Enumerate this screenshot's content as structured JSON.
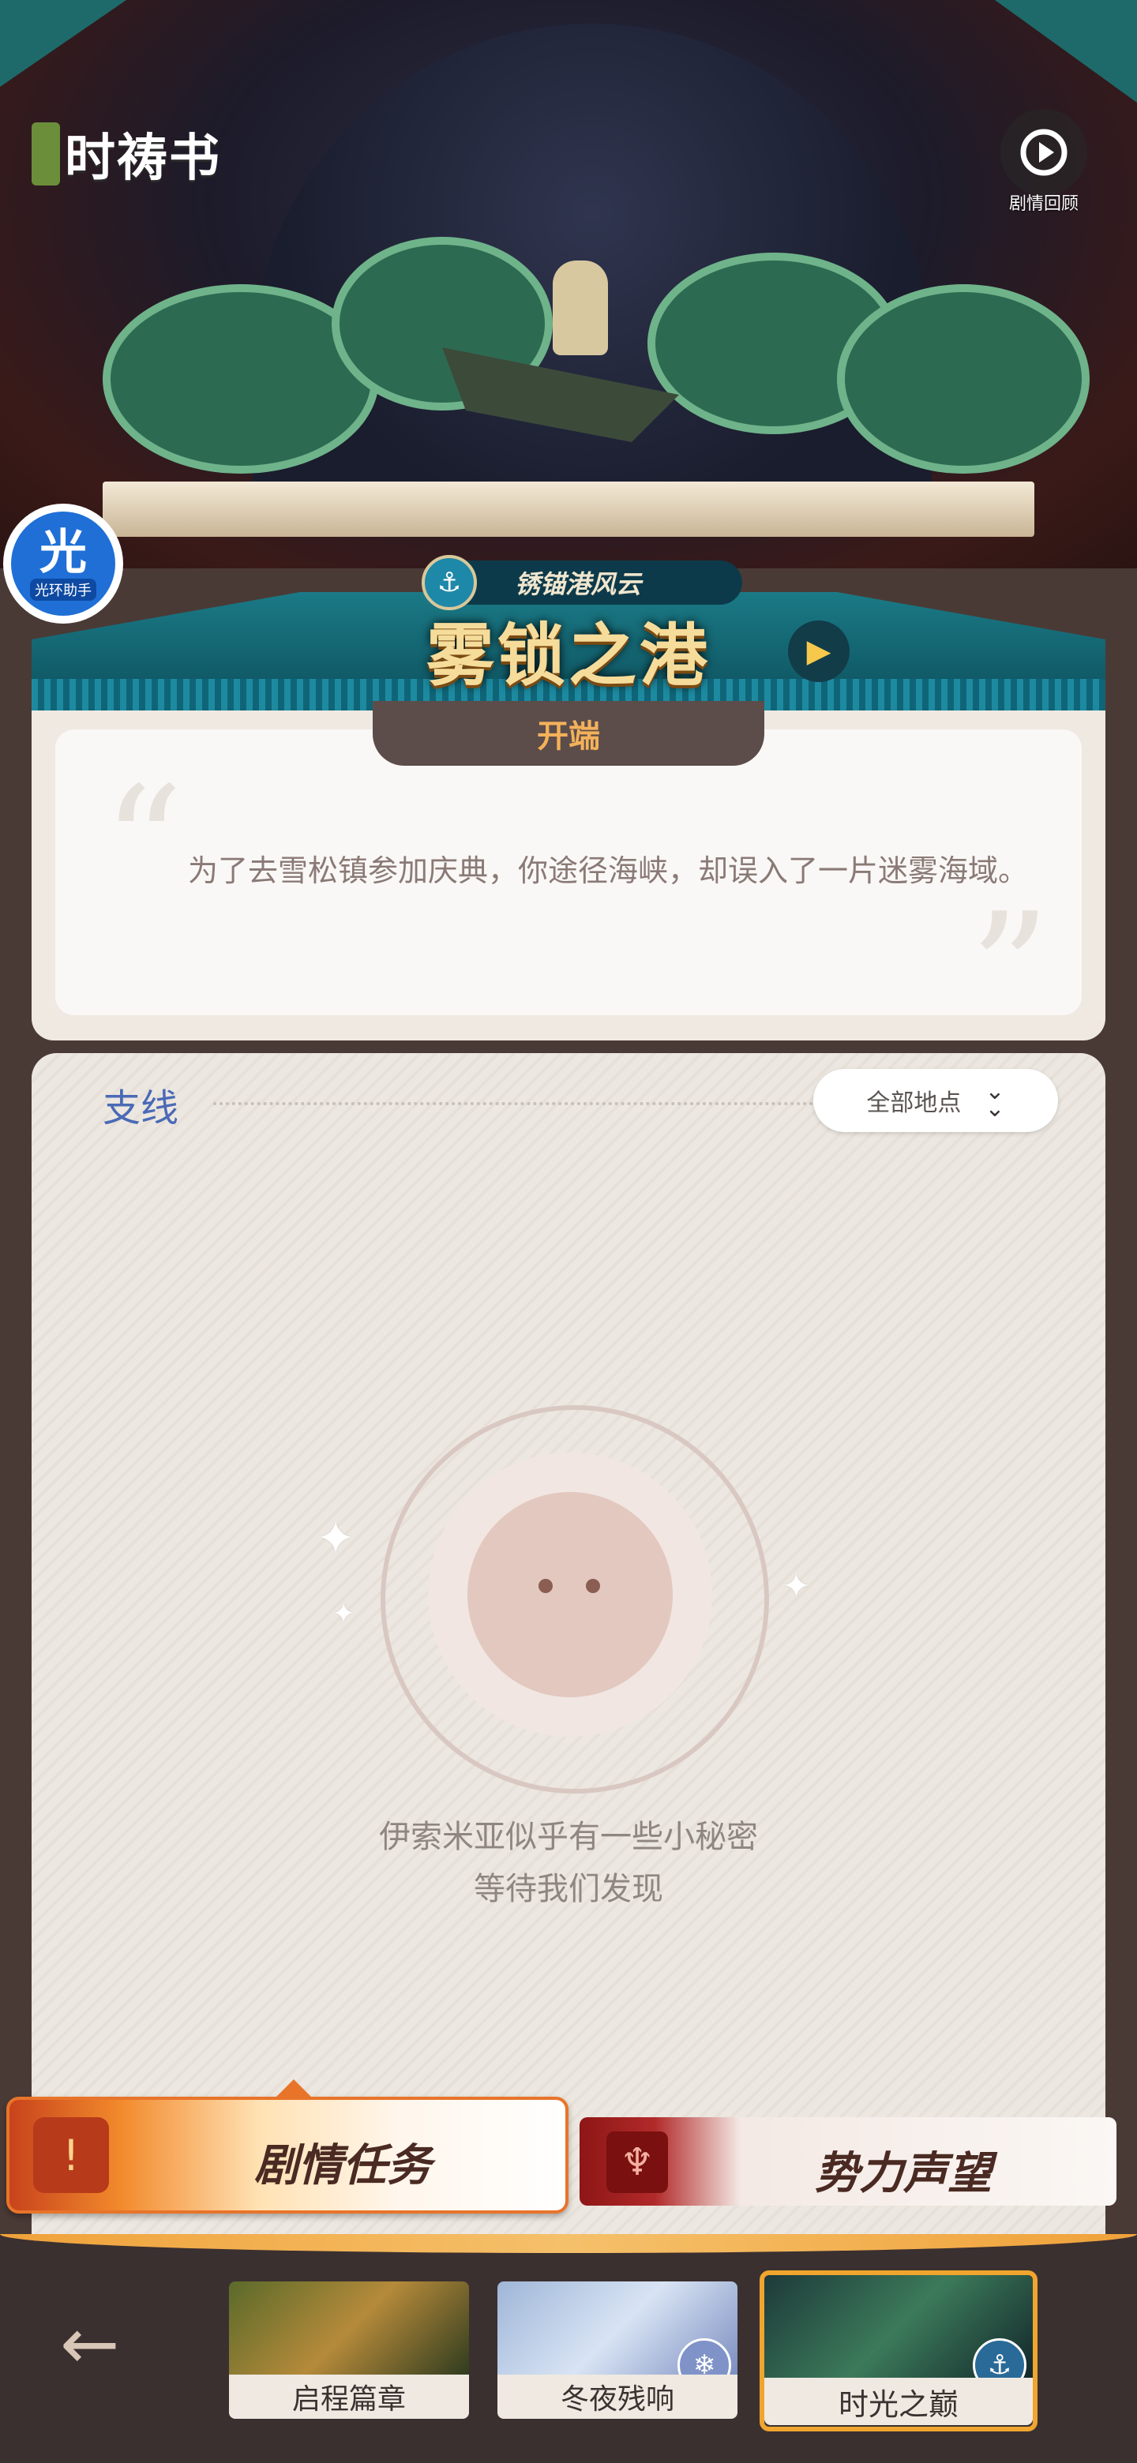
{
  "app": {
    "logo_text": "时祷书"
  },
  "header": {
    "replay_label": "剧情回顾",
    "assistant_label": "光环助手",
    "assistant_glyph": "光"
  },
  "chapter": {
    "subtitle": "锈锚港风云",
    "title": "雾锁之港",
    "intro_tab": "开端",
    "intro_text": "为了去雪松镇参加庆典，你途径海峡，却误入了一片迷雾海域。"
  },
  "side_quests": {
    "title": "支线",
    "filter_label": "全部地点",
    "empty_line1": "伊索米亚似乎有一些小秘密",
    "empty_line2": "等待我们发现"
  },
  "mode_tabs": [
    {
      "label": "剧情任务",
      "active": true
    },
    {
      "label": "势力声望",
      "active": false
    }
  ],
  "chapters": [
    {
      "label": "启程篇章",
      "selected": false
    },
    {
      "label": "冬夜残响",
      "selected": false
    },
    {
      "label": "时光之巅",
      "selected": true
    }
  ],
  "icons": {
    "replay": "replay-icon",
    "anchor": "anchor-icon",
    "next": "chevron-right-icon",
    "filter": "double-chevron-down-icon",
    "back": "arrow-left-icon",
    "story": "story-quest-icon",
    "reputation": "faction-reputation-icon"
  },
  "colors": {
    "accent": "#f0a52e",
    "title_gold": "#f6dc9a",
    "side_title": "#4a6ab6",
    "intro_tab_text": "#f4b15a"
  }
}
